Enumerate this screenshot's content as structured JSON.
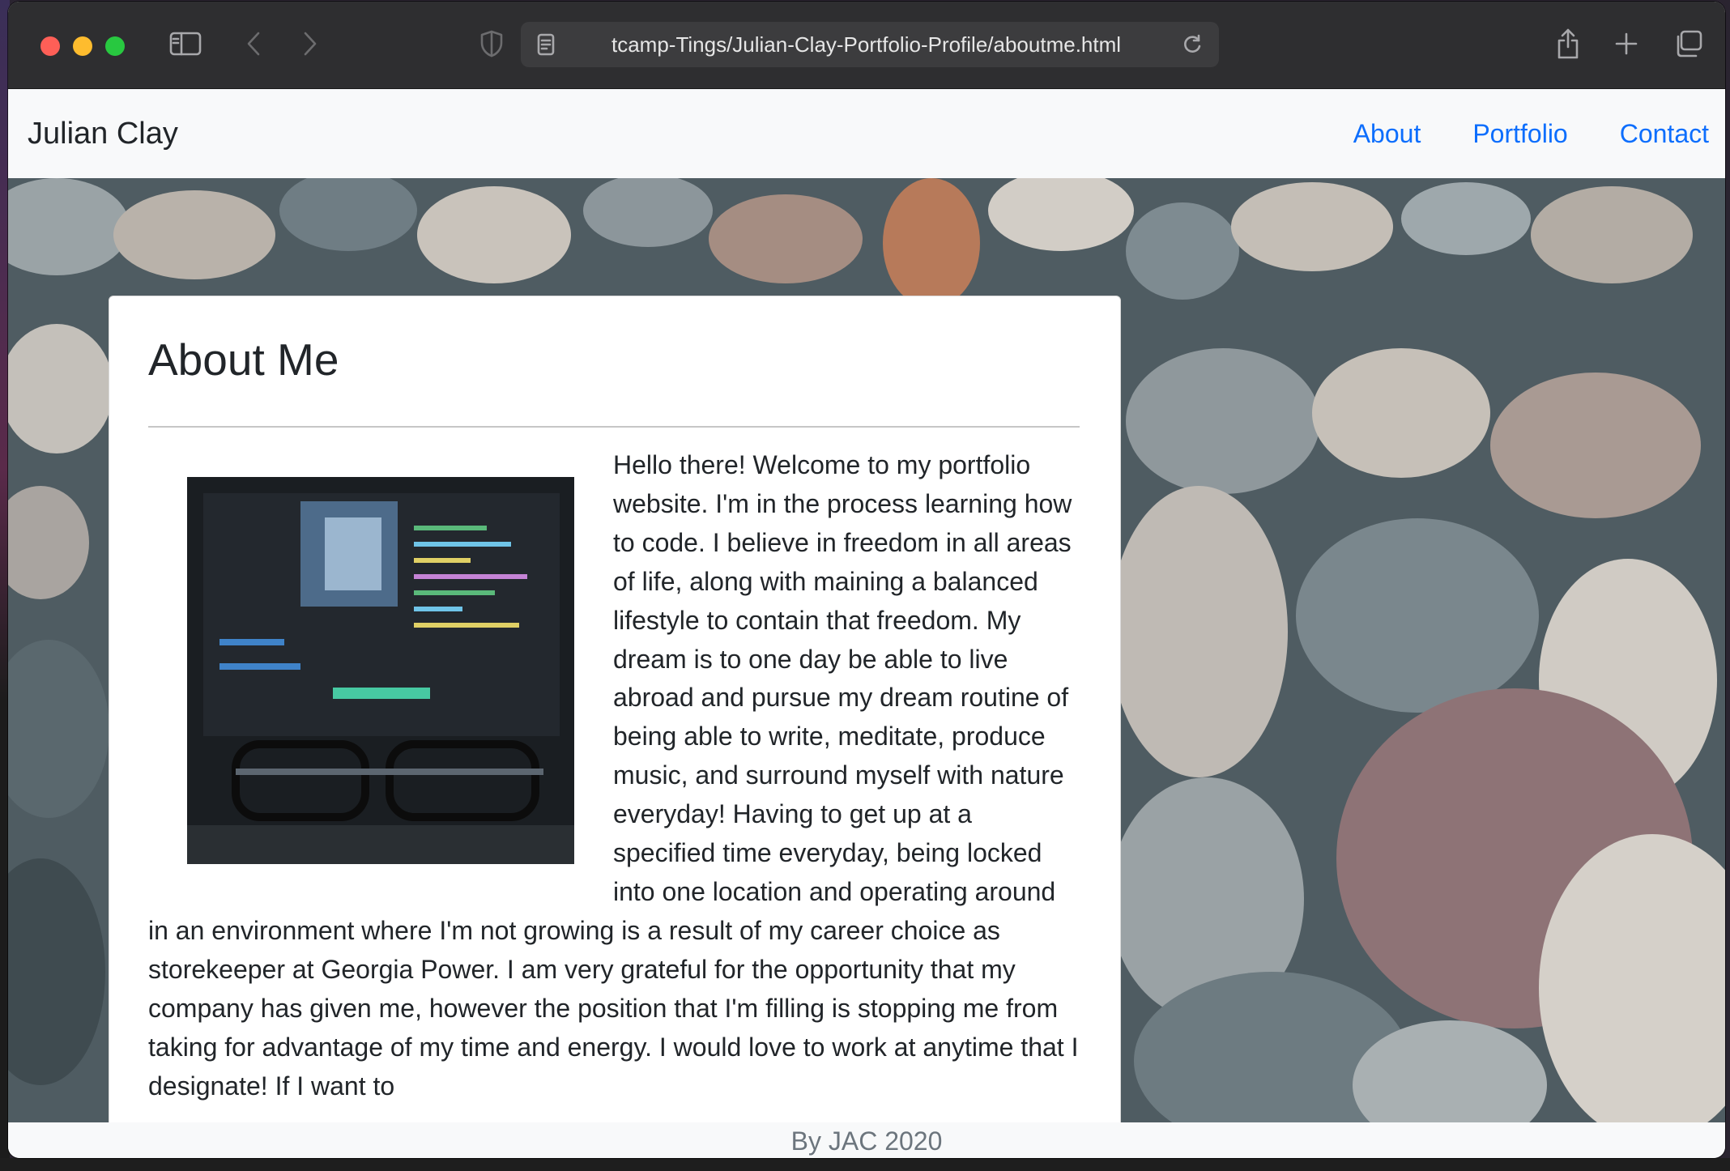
{
  "browser": {
    "url": "tcamp-Tings/Julian-Clay-Portfolio-Profile/aboutme.html"
  },
  "navbar": {
    "brand": "Julian Clay",
    "links": [
      "About",
      "Portfolio",
      "Contact"
    ],
    "link_color": "#0d6efd"
  },
  "card": {
    "title": "About Me",
    "image_icon": "code-screen-with-glasses-photo",
    "paragraph": "Hello there! Welcome to my portfolio website. I'm in the process learning how to code. I believe in freedom in all areas of life, along with maining a balanced lifestyle to contain that freedom. My dream is to one day be able to live abroad and pursue my dream routine of being able to write, meditate, produce music, and surround myself with nature everyday! Having to get up at a specified time everyday, being locked into one location and operating around in an environment where I'm not growing is a result of my career choice as storekeeper at Georgia Power. I am very grateful for the opportunity that my company has given me, however the position that I'm filling is stopping me from taking for advantage of my time and energy. I would love to work at anytime that I designate! If I want to"
  },
  "footer": {
    "text": "By JAC 2020"
  },
  "icons": [
    "sidebar-icon",
    "back-icon",
    "forward-icon",
    "shield-icon",
    "reader-icon",
    "reload-icon",
    "share-icon",
    "new-tab-icon",
    "tabs-overview-icon"
  ]
}
